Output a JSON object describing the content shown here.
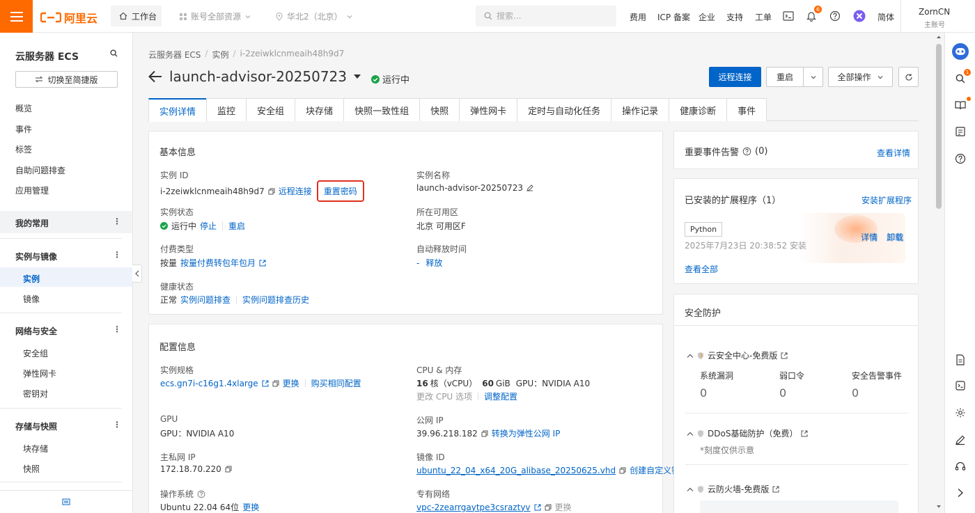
{
  "topbar": {
    "logo_text": "阿里云",
    "workspace": "工作台",
    "resource_scope": "账号全部资源",
    "region": "华北2（北京）",
    "search_placeholder": "搜索...",
    "links": [
      "费用",
      "ICP 备案",
      "企业",
      "支持",
      "工单"
    ],
    "bell_badge": "6",
    "lang": "简体",
    "user_name": "ZornCN",
    "user_role": "主账号"
  },
  "sidebar": {
    "title": "云服务器 ECS",
    "switch_button": "切换至简捷版",
    "top_items": [
      "概览",
      "事件",
      "标签",
      "自助问题排查",
      "应用管理"
    ],
    "my_common": "我的常用",
    "groups": [
      {
        "title": "实例与镜像",
        "items": [
          "实例",
          "镜像"
        ]
      },
      {
        "title": "网络与安全",
        "items": [
          "安全组",
          "弹性网卡",
          "密钥对"
        ]
      },
      {
        "title": "存储与快照",
        "items": [
          "块存储",
          "快照"
        ]
      }
    ],
    "active_item": "实例"
  },
  "breadcrumb": [
    "云服务器 ECS",
    "实例",
    "i-2zeiwklcnmeaih48h9d7"
  ],
  "header": {
    "title": "launch-advisor-20250723",
    "status": "运行中",
    "btn_remote": "远程连接",
    "btn_restart": "重启",
    "btn_all_ops": "全部操作"
  },
  "tabs": [
    "实例详情",
    "监控",
    "安全组",
    "块存储",
    "快照一致性组",
    "快照",
    "弹性网卡",
    "定时与自动化任务",
    "操作记录",
    "健康诊断",
    "事件"
  ],
  "basic": {
    "title": "基本信息",
    "instance_id_label": "实例 ID",
    "instance_id": "i-2zeiwklcnmeaih48h9d7",
    "remote_link": "远程连接",
    "reset_pwd": "重置密码",
    "instance_name_label": "实例名称",
    "instance_name": "launch-advisor-20250723",
    "status_label": "实例状态",
    "status": "运行中",
    "stop": "停止",
    "restart": "重启",
    "zone_label": "所在可用区",
    "zone": "北京 可用区F",
    "billing_label": "付费类型",
    "billing": "按量",
    "billing_link": "按量付费转包年包月",
    "release_label": "自动释放时间",
    "release_value": "-",
    "release_link": "释放",
    "health_label": "健康状态",
    "health": "正常",
    "health_link1": "实例问题排查",
    "health_link2": "实例问题排查历史"
  },
  "config": {
    "title": "配置信息",
    "spec_label": "实例规格",
    "spec": "ecs.gn7i-c16g1.4xlarge",
    "spec_change": "更换",
    "spec_buy": "购买相同配置",
    "cpu_label": "CPU & 内存",
    "cpu_num": "16",
    "cpu_unit": "核（vCPU）",
    "mem_num": "60",
    "mem_unit": "GiB",
    "gpu_inline": "GPU：NVIDIA A10",
    "cpu_option": "更改 CPU 选项",
    "adjust": "调整配置",
    "gpu_label": "GPU",
    "gpu": "GPU：NVIDIA A10",
    "public_ip_label": "公网 IP",
    "public_ip": "39.96.218.182",
    "eip_link": "转换为弹性公网 IP",
    "private_ip_label": "主私网 IP",
    "private_ip": "172.18.70.220",
    "image_label": "镜像 ID",
    "image": "ubuntu_22_04_x64_20G_alibase_20250625.vhd",
    "image_create": "创建自定义镜像",
    "os_label": "操作系统",
    "os": "Ubuntu 22.04 64位",
    "os_change": "更换",
    "vpc_label": "专有网络",
    "vpc": "vpc-2zearrgaytpe3csraztyv",
    "vpc_change": "更换"
  },
  "events": {
    "title": "重要事件告警",
    "count": "(0)",
    "link": "查看详情"
  },
  "extensions": {
    "title": "已安装的扩展程序（1）",
    "install": "安装扩展程序",
    "tag": "Python",
    "installed_time": "2025年7月23日 20:38:52 安装",
    "detail": "详情",
    "uninstall": "卸载",
    "view_all": "查看全部"
  },
  "security": {
    "title": "安全防护",
    "center": "云安全中心-免费版",
    "vuln_label": "系统漏洞",
    "vuln": "0",
    "weak_label": "弱口令",
    "weak": "0",
    "alert_label": "安全告警事件",
    "alert": "0",
    "ddos": "DDoS基础防护（免费）",
    "ddos_note": "*刻度仅供示意",
    "firewall": "云防火墙-免费版"
  },
  "colors": {
    "brand": "#ff6a00",
    "link": "#0064c8",
    "success": "#1aa34a",
    "highlight": "#e0301e"
  }
}
